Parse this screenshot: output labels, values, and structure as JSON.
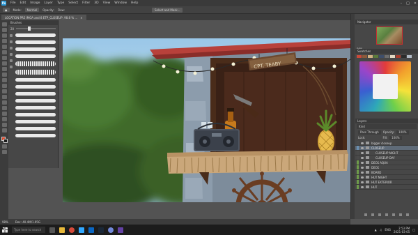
{
  "app": {
    "logo": "Ps",
    "menu": [
      "File",
      "Edit",
      "Image",
      "Layer",
      "Type",
      "Select",
      "Filter",
      "3D",
      "View",
      "Window",
      "Help"
    ],
    "window_controls": [
      "–",
      "□",
      "×"
    ]
  },
  "options": {
    "mode": "Mode:",
    "mode_value": "Normal",
    "opacity": "Opacity:",
    "flow": "Flow:",
    "select_button": "Select and Mask..."
  },
  "document": {
    "tab_title": "LOCATION PRE IMOA and 8 ETP_CLOSEUP, 98.8 % ...",
    "close": "×"
  },
  "brushes": {
    "title": "Brushes",
    "size_value": "20"
  },
  "navigator": {
    "title": "Navigator",
    "zoom": "98%"
  },
  "swatches": {
    "title": "Swatches"
  },
  "layers": {
    "title": "Layers",
    "search": "Kind",
    "blend": "Pass Through",
    "opacity_label": "Opacity:",
    "opacity_value": "100%",
    "fill_label": "Fill:",
    "fill_value": "100%",
    "lock_label": "Lock:",
    "rows": [
      {
        "label": "bigger closeup",
        "color": "#4a4a4a"
      },
      {
        "label": "CLOSEUP",
        "color": "#6a8fb0",
        "selected": true
      },
      {
        "label": "CLOSEUP NIGHT",
        "color": "#4a4a4a",
        "indent": true
      },
      {
        "label": "CLOSEUP DAY",
        "color": "#4a4a4a",
        "indent": true
      },
      {
        "label": "DECK AQUA",
        "color": "#6e9b4a"
      },
      {
        "label": "DECK",
        "color": "#6e9b4a"
      },
      {
        "label": "BOARD",
        "color": "#6e9b4a"
      },
      {
        "label": "HUT NIGHT",
        "color": "#6e9b4a"
      },
      {
        "label": "HUT EXTERIOR",
        "color": "#6e9b4a"
      },
      {
        "label": "HUT",
        "color": "#6e9b4a"
      }
    ]
  },
  "status": {
    "zoom": "98%",
    "doc": "Doc: 40.4M/1.95G"
  },
  "canvas": {
    "sign_text": "CPT. TEABY"
  },
  "taskbar": {
    "search_placeholder": "Type here to search",
    "lang": "ENG",
    "time": "2:53 PM",
    "date": "2021-03-05"
  }
}
